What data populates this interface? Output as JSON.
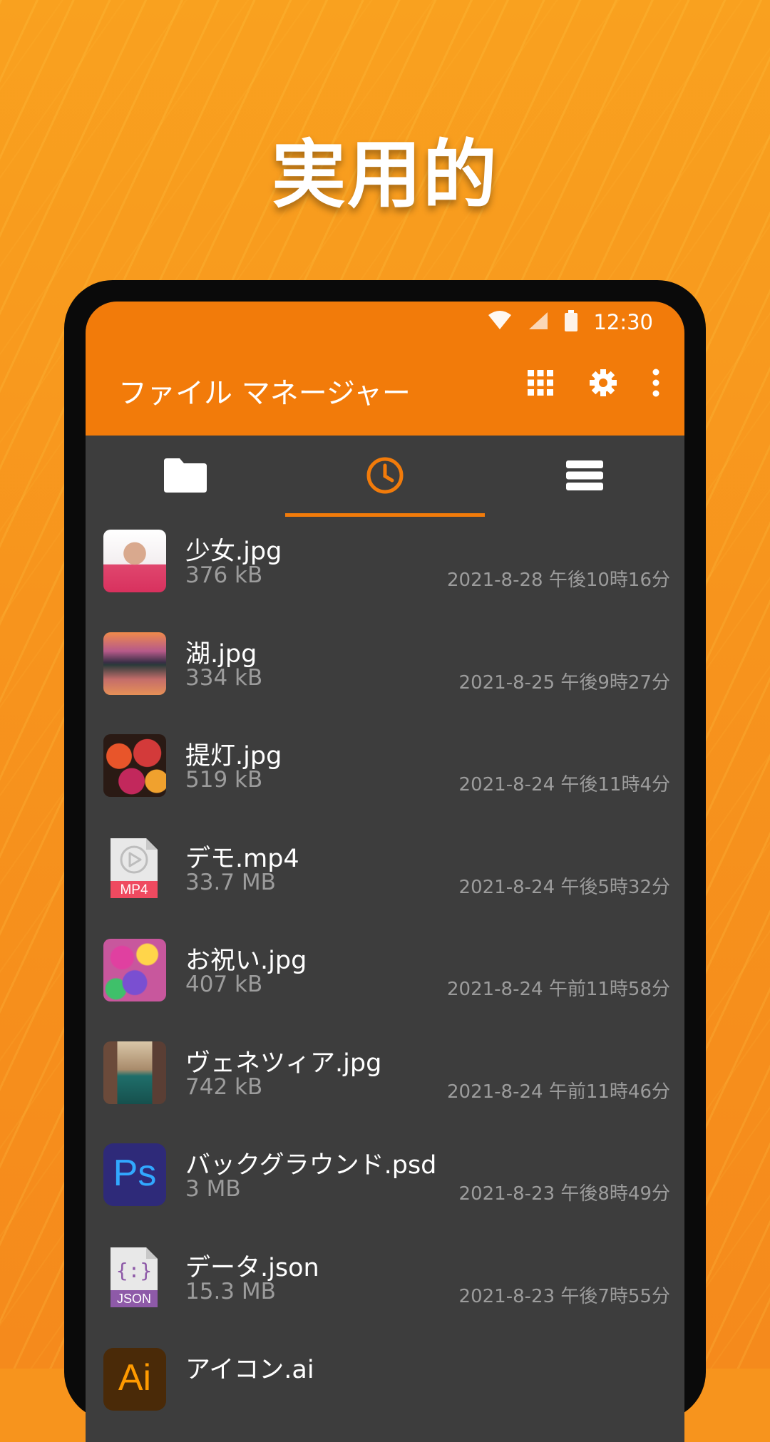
{
  "headline": "実用的",
  "status_bar": {
    "time": "12:30"
  },
  "app_bar": {
    "title": "ファイル マネージャー",
    "icons": [
      "grid-view-icon",
      "settings-gear-icon",
      "more-vert-icon"
    ]
  },
  "tabs": [
    {
      "icon": "folder-icon",
      "active": false
    },
    {
      "icon": "clock-recent-icon",
      "active": true
    },
    {
      "icon": "storage-list-icon",
      "active": false
    }
  ],
  "files": [
    {
      "name": "少女.jpg",
      "size": "376 kB",
      "date": "2021-8-28 午後10時16分",
      "thumb": "girl-photo"
    },
    {
      "name": "湖.jpg",
      "size": "334 kB",
      "date": "2021-8-25 午後9時27分",
      "thumb": "lake-photo"
    },
    {
      "name": "提灯.jpg",
      "size": "519 kB",
      "date": "2021-8-24 午後11時4分",
      "thumb": "lantern-photo"
    },
    {
      "name": "デモ.mp4",
      "size": "33.7 MB",
      "date": "2021-8-24 午後5時32分",
      "thumb": "mp4-file-icon",
      "badge": "MP4"
    },
    {
      "name": "お祝い.jpg",
      "size": "407 kB",
      "date": "2021-8-24 午前11時58分",
      "thumb": "celebration-photo"
    },
    {
      "name": "ヴェネツィア.jpg",
      "size": "742 kB",
      "date": "2021-8-24 午前11時46分",
      "thumb": "venice-photo"
    },
    {
      "name": "バックグラウンド.psd",
      "size": "3 MB",
      "date": "2021-8-23 午後8時49分",
      "thumb": "photoshop-file-icon",
      "badge": "Ps"
    },
    {
      "name": "データ.json",
      "size": "15.3 MB",
      "date": "2021-8-23 午後7時55分",
      "thumb": "json-file-icon",
      "badge": "JSON",
      "glyph": "{:}"
    },
    {
      "name": "アイコン.ai",
      "size": "",
      "date": "",
      "thumb": "illustrator-file-icon",
      "badge": "Ai"
    }
  ],
  "colors": {
    "accent": "#f27b0a",
    "background": "#f7941d",
    "list_bg": "#3d3d3d",
    "secondary_text": "#9c9c9c"
  }
}
